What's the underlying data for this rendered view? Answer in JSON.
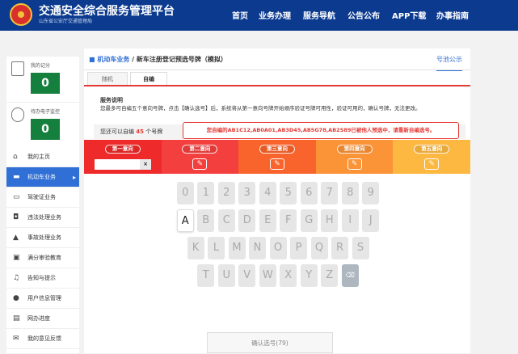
{
  "header": {
    "site_title": "交通安全综合服务管理平台",
    "site_subtitle": "山东省公安厅交通管理局",
    "nav": [
      "首页",
      "业务办理",
      "服务导航",
      "公告公布",
      "APP下载",
      "办事指南"
    ]
  },
  "sidebar": {
    "score_label": "我的记分",
    "score_value": "0",
    "ticket_label": "待办电子监控",
    "ticket_value": "0",
    "items": [
      {
        "label": "我的主页",
        "icon": "home-icon",
        "glyph": "⌂"
      },
      {
        "label": "机动车业务",
        "icon": "car-icon",
        "glyph": "▬"
      },
      {
        "label": "驾驶证业务",
        "icon": "card-icon",
        "glyph": "▭"
      },
      {
        "label": "违法处理业务",
        "icon": "camera-icon",
        "glyph": "◘"
      },
      {
        "label": "事故处理业务",
        "icon": "warning-icon",
        "glyph": "▲"
      },
      {
        "label": "满分审验教育",
        "icon": "monitor-icon",
        "glyph": "▣"
      },
      {
        "label": "告知与提示",
        "icon": "bell-icon",
        "glyph": "♫"
      },
      {
        "label": "用户信息管理",
        "icon": "user-icon",
        "glyph": "●"
      },
      {
        "label": "网办进度",
        "icon": "progress-icon",
        "glyph": "▤"
      },
      {
        "label": "我的意见反馈",
        "icon": "feedback-icon",
        "glyph": "✉"
      }
    ],
    "active_index": 1
  },
  "main": {
    "breadcrumb_section": "机动车业务",
    "breadcrumb_page": " / 新车注册登记预选号牌（模拟）",
    "pool_link": "号池公示",
    "tabs": [
      "随机",
      "自编"
    ],
    "active_tab": 1,
    "service_title": "服务说明",
    "service_desc": "您最多可自编五个意向号牌，点击【确认选号】后，系统将从第一意向号牌开始顺序验证号牌可用性，验证可用的，确认号牌，无法更改。",
    "remaining_prefix": "您还可以自编",
    "remaining_count": "45",
    "remaining_suffix": "个号牌",
    "error_message": "您自编的AB1C12,AB0A01,AB3D45,AB5G78,AB2S89已被他人预选中，请重新自编选号。",
    "orders": [
      {
        "label": "第一意向",
        "color": "#ee2a2a"
      },
      {
        "label": "第二意向",
        "color": "#f43f3f"
      },
      {
        "label": "第三意向",
        "color": "#f9642c"
      },
      {
        "label": "第四意向",
        "color": "#fb9337"
      },
      {
        "label": "第五意向",
        "color": "#fcb840"
      }
    ],
    "order_input_value": "",
    "clear_symbol": "×",
    "edit_symbol": "✎",
    "keypad_rows": [
      [
        "0",
        "1",
        "2",
        "3",
        "4",
        "5",
        "6",
        "7",
        "8",
        "9"
      ],
      [
        "A",
        "B",
        "C",
        "D",
        "E",
        "F",
        "G",
        "H",
        "I",
        "J"
      ],
      [
        "K",
        "L",
        "M",
        "N",
        "O",
        "P",
        "Q",
        "R",
        "S"
      ],
      [
        "T",
        "U",
        "V",
        "W",
        "X",
        "Y",
        "Z"
      ]
    ],
    "enabled_keys": [
      "A"
    ],
    "delete_key": "⌫",
    "confirm_label": "确认选号(79)"
  }
}
